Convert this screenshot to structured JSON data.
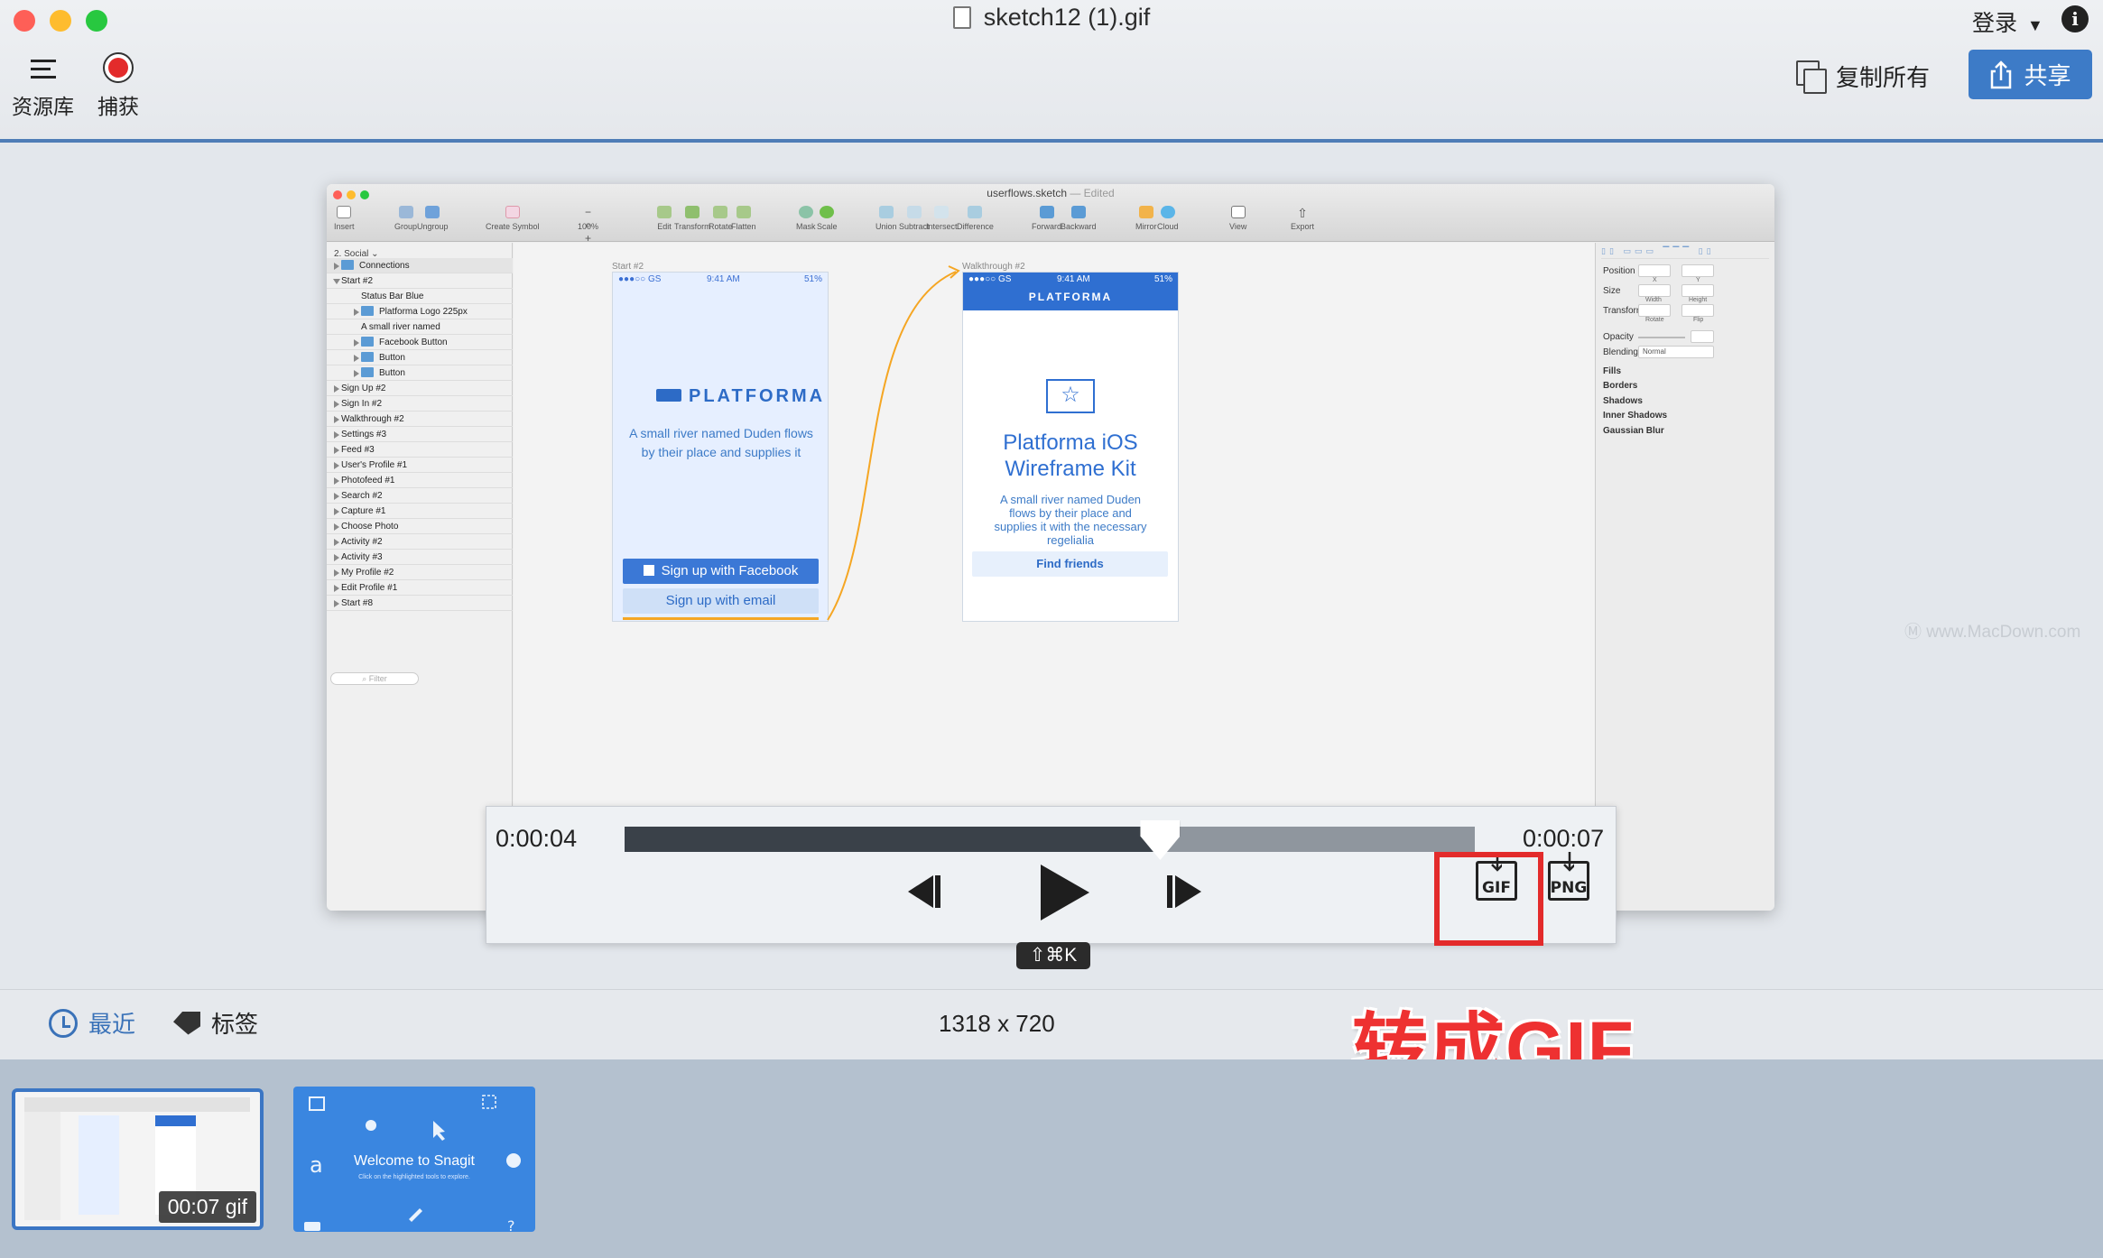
{
  "window": {
    "title": "sketch12 (1).gif",
    "login_label": "登录",
    "info_icon": "i"
  },
  "toolbar": {
    "library_label": "资源库",
    "capture_label": "捕获",
    "copy_all_label": "复制所有",
    "share_label": "共享"
  },
  "sketch": {
    "title": "userflows.sketch",
    "edited": "— Edited",
    "page": "2. Social",
    "filter_placeholder": "Filter",
    "tools": [
      "Insert",
      "Group",
      "Ungroup",
      "Create Symbol",
      "100%",
      "Edit",
      "Transform",
      "Rotate",
      "Flatten",
      "Mask",
      "Scale",
      "Union",
      "Subtract",
      "Intersect",
      "Difference",
      "Forward",
      "Backward",
      "Mirror",
      "Cloud",
      "View",
      "Export"
    ],
    "layers": [
      "Connections",
      "Start #2",
      "Status Bar Blue",
      "Platforma Logo 225px",
      "A small river named",
      "Facebook Button",
      "Button",
      "Button",
      "Sign Up #2",
      "Sign In #2",
      "Walkthrough #2",
      "Settings #3",
      "Feed #3",
      "User's Profile #1",
      "Photofeed #1",
      "Search #2",
      "Capture #1",
      "Choose Photo",
      "Activity #2",
      "Activity #3",
      "My Profile #2",
      "Edit Profile #1",
      "Start #8"
    ],
    "inspector": {
      "position": "Position",
      "x": "X",
      "y": "Y",
      "size": "Size",
      "width": "Width",
      "height": "Height",
      "transform": "Transform",
      "rotate": "Rotate",
      "flip": "Flip",
      "opacity": "Opacity",
      "blending": "Blending",
      "blending_value": "Normal",
      "fills": "Fills",
      "borders": "Borders",
      "shadows": "Shadows",
      "inner_shadows": "Inner Shadows",
      "gaussian_blur": "Gaussian Blur"
    },
    "artboard1": {
      "label": "Start #2",
      "carrier": "●●●○○ GS",
      "time": "9:41 AM",
      "battery": "51%",
      "logo": "PLATFORMA",
      "tagline": "A small river named Duden flows by their place and supplies it",
      "facebook_btn": "Sign up with Facebook",
      "email_btn": "Sign up with email"
    },
    "artboard2": {
      "label": "Walkthrough #2",
      "carrier": "●●●○○ GS",
      "time": "9:41 AM",
      "battery": "51%",
      "header": "PLATFORMA",
      "title_line1": "Platforma iOS",
      "title_line2": "Wireframe Kit",
      "desc": "A small river named Duden flows by their place and supplies it with the necessary regelialia",
      "button": "Find friends"
    }
  },
  "player": {
    "time_current": "0:00:04",
    "time_total": "0:00:07",
    "progress": 0.63,
    "gif_label": "GIF",
    "png_label": "PNG",
    "shortcut": "⇧⌘K"
  },
  "watermark": "www.MacDown.com",
  "annotation": "转成GIF",
  "bottom": {
    "recent_label": "最近",
    "tags_label": "标签",
    "dimensions": "1318 x 720"
  },
  "tray": {
    "thumb1_label": "00:07 gif",
    "thumb2_title": "Welcome to Snagit",
    "thumb2_sub": "Click on the highlighted tools to explore."
  },
  "colors": {
    "accent": "#3d7bc7",
    "record": "#e32b2b",
    "annotation": "#ee3131",
    "tray": "#b4c1cf",
    "phone_blue": "#2f6fd1"
  }
}
